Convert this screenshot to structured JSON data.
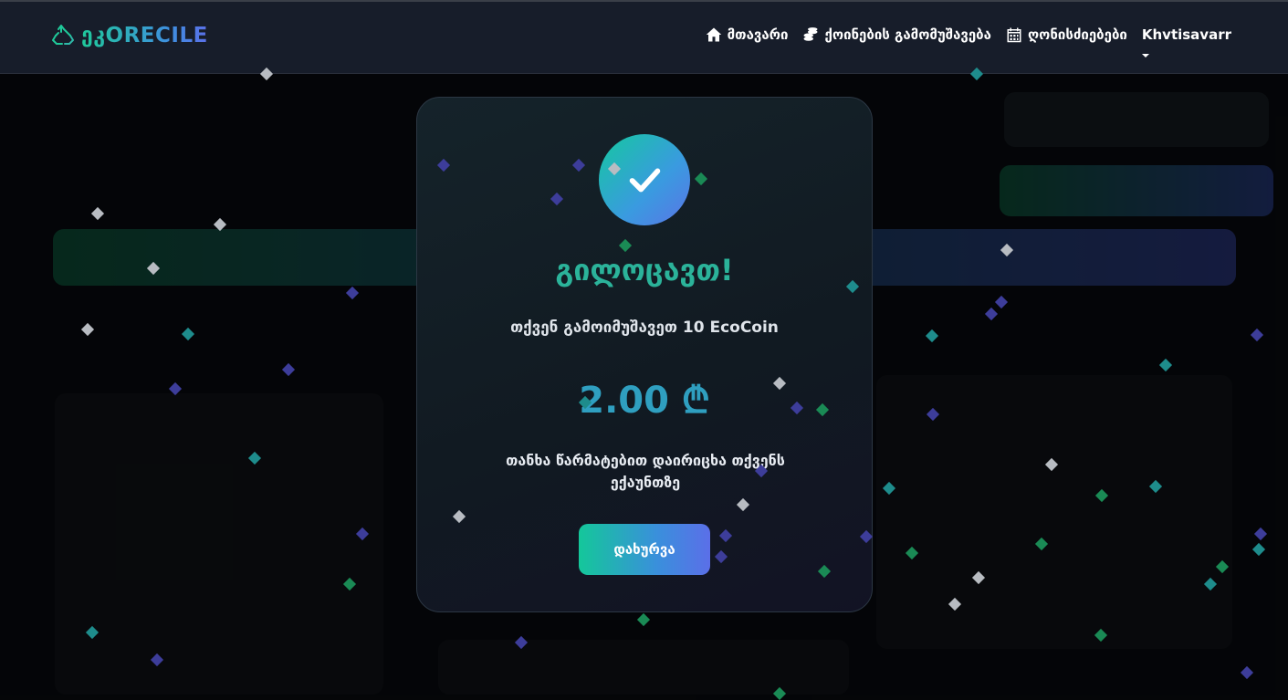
{
  "navbar": {
    "brand": "ეკორecile",
    "brand_display": "ეკORECILE",
    "links": [
      {
        "label": "მთავარი",
        "icon": "home-icon"
      },
      {
        "label": "ქოინების გამომუშავება",
        "icon": "coins-icon"
      },
      {
        "label": "ღონისძიებები",
        "icon": "calendar-icon"
      }
    ],
    "user": "Khvtisavarr"
  },
  "modal": {
    "title": "გილოცავთ!",
    "subtitle": "თქვენ გამოიმუშავეთ 10 EcoCoin",
    "amount": "2.00 ₾",
    "note": "თანხა წარმატებით დაირიცხა თქვენს ექაუნთზე",
    "close_label": "დახურვა"
  },
  "colors": {
    "accent_green": "#14c79a",
    "accent_blue": "#5b6fe8",
    "title_teal": "#2bb39a",
    "amount_blue": "#2f9fc0",
    "navbar_bg": "#171d2a"
  }
}
